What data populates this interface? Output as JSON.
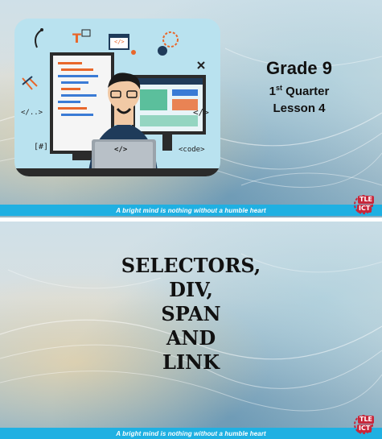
{
  "slide1": {
    "grade": "Grade 9",
    "quarter_num": "1",
    "quarter_sup": "st",
    "quarter_word": "Quarter",
    "lesson": "Lesson 4",
    "illustration": {
      "code_tag_left": "</..>",
      "code_tag_right": "</>",
      "hash_tag": "[#]",
      "code_word": "<code>",
      "laptop_tag": "</>",
      "window_tag": "</>"
    },
    "footer": "A bright mind is nothing without a humble heart",
    "logo_top": "TLE",
    "logo_bottom": "ICT"
  },
  "slide2": {
    "title_lines": [
      "SELECTORS,",
      "DIV,",
      "SPAN",
      "AND",
      "LINK"
    ],
    "footer": "A bright mind is nothing without a humble heart",
    "logo_top": "TLE",
    "logo_bottom": "ICT"
  },
  "colors": {
    "footer_bar": "#1fb0e2",
    "hero_bg": "#b9e2ef",
    "logo_red": "#c8263a"
  }
}
